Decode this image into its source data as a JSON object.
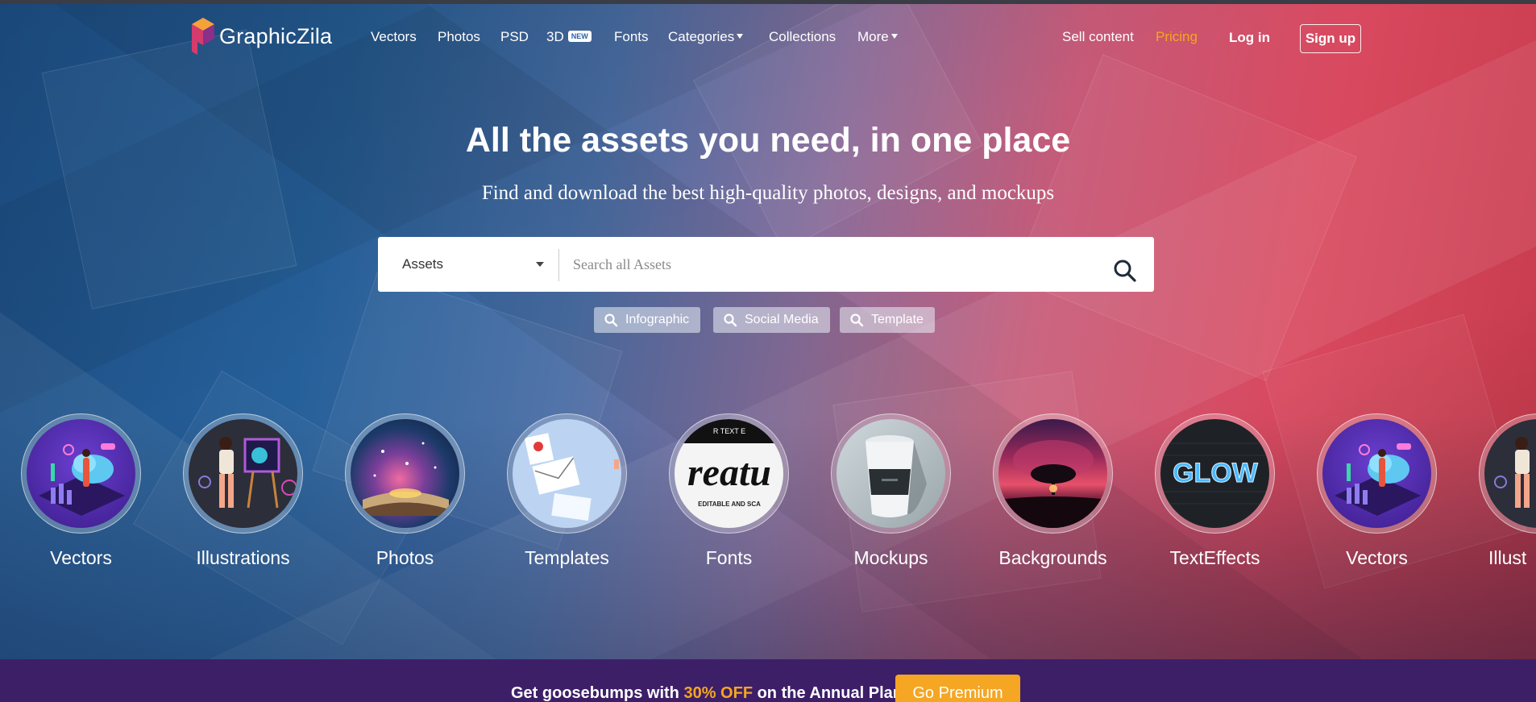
{
  "brand": {
    "name": "GraphicZila"
  },
  "nav": {
    "links": {
      "vectors": "Vectors",
      "photos": "Photos",
      "psd": "PSD",
      "three_d": "3D",
      "three_d_badge": "NEW",
      "fonts": "Fonts",
      "categories": "Categories",
      "collections": "Collections",
      "more": "More"
    },
    "sell": "Sell content",
    "pricing": "Pricing",
    "login": "Log in",
    "signup": "Sign up"
  },
  "hero": {
    "title": "All the assets you need, in one place",
    "subtitle": "Find and download the best high-quality photos, designs, and mockups"
  },
  "search": {
    "type_selected": "Assets",
    "placeholder": "Search all Assets",
    "value": ""
  },
  "suggestions": [
    "Infographic",
    "Social Media",
    "Template"
  ],
  "categories": [
    {
      "label": "Vectors",
      "icon": "vectors-thumbnail"
    },
    {
      "label": "Illustrations",
      "icon": "illustrations-thumbnail"
    },
    {
      "label": "Photos",
      "icon": "photos-thumbnail"
    },
    {
      "label": "Templates",
      "icon": "templates-thumbnail"
    },
    {
      "label": "Fonts",
      "icon": "fonts-thumbnail",
      "art_text": "reatu",
      "art_small": "EDITABLE AND SCA",
      "art_top": "R TEXT E"
    },
    {
      "label": "Mockups",
      "icon": "mockups-thumbnail"
    },
    {
      "label": "Backgrounds",
      "icon": "backgrounds-thumbnail"
    },
    {
      "label": "TextEffects",
      "icon": "texteffects-thumbnail",
      "art_text": "GLOW"
    },
    {
      "label": "Vectors",
      "icon": "vectors-thumbnail"
    },
    {
      "label": "Illust",
      "icon": "illustrations-thumbnail"
    }
  ],
  "banner": {
    "text_before": "Get goosebumps with ",
    "highlight": "30% OFF",
    "text_after": " on the Annual Plan",
    "button": "Go Premium"
  },
  "colors": {
    "accent": "#f5a623",
    "banner_bg": "#3d1f68",
    "gradient_left": "#1d4f86",
    "gradient_right": "#c63a4c"
  }
}
